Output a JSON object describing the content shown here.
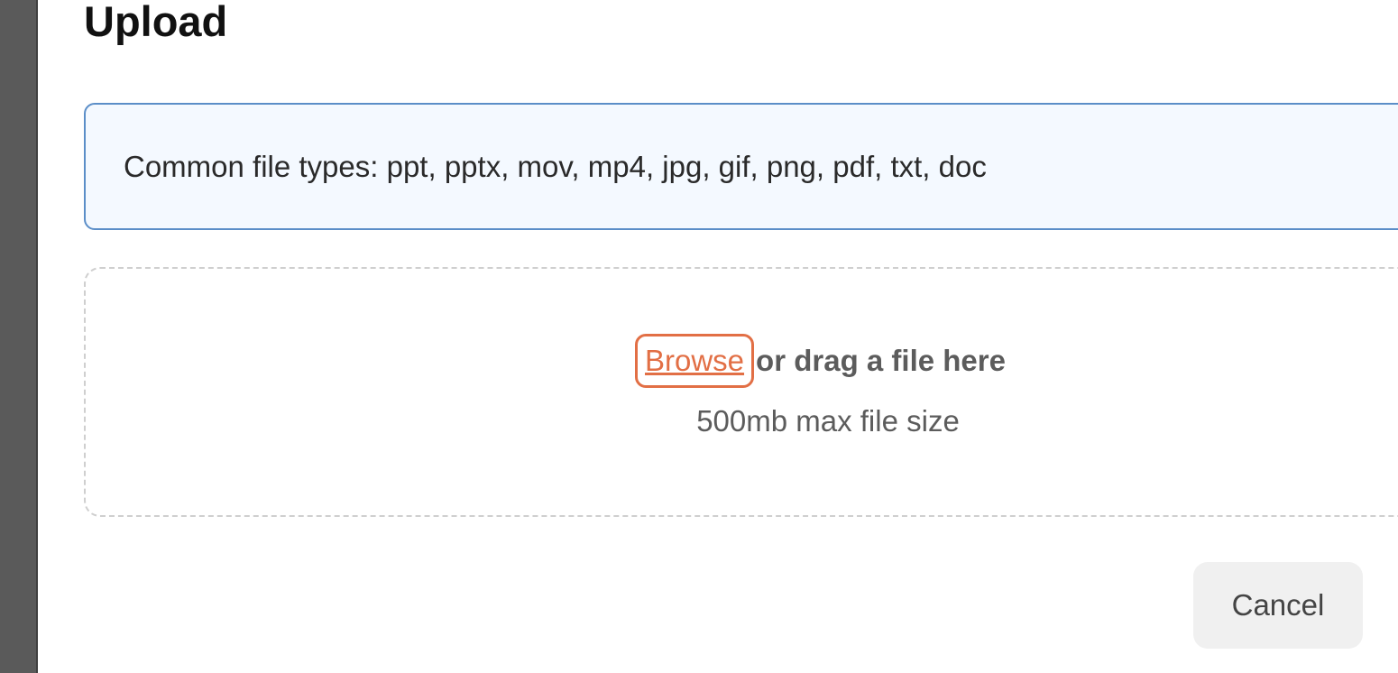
{
  "modal": {
    "title": "Upload",
    "info": {
      "text": "Common file types: ppt, pptx, mov, mp4, jpg, gif, png, pdf, txt, doc"
    },
    "dropzone": {
      "browse_label": "Browse",
      "drag_label": "or drag a file here",
      "max_size": "500mb max file size"
    },
    "cancel_label": "Cancel"
  },
  "colors": {
    "info_border": "#5b8ec8",
    "info_background": "#f4f9ff",
    "browse_accent": "#e26f45",
    "overlay": "#5a5a5a"
  }
}
